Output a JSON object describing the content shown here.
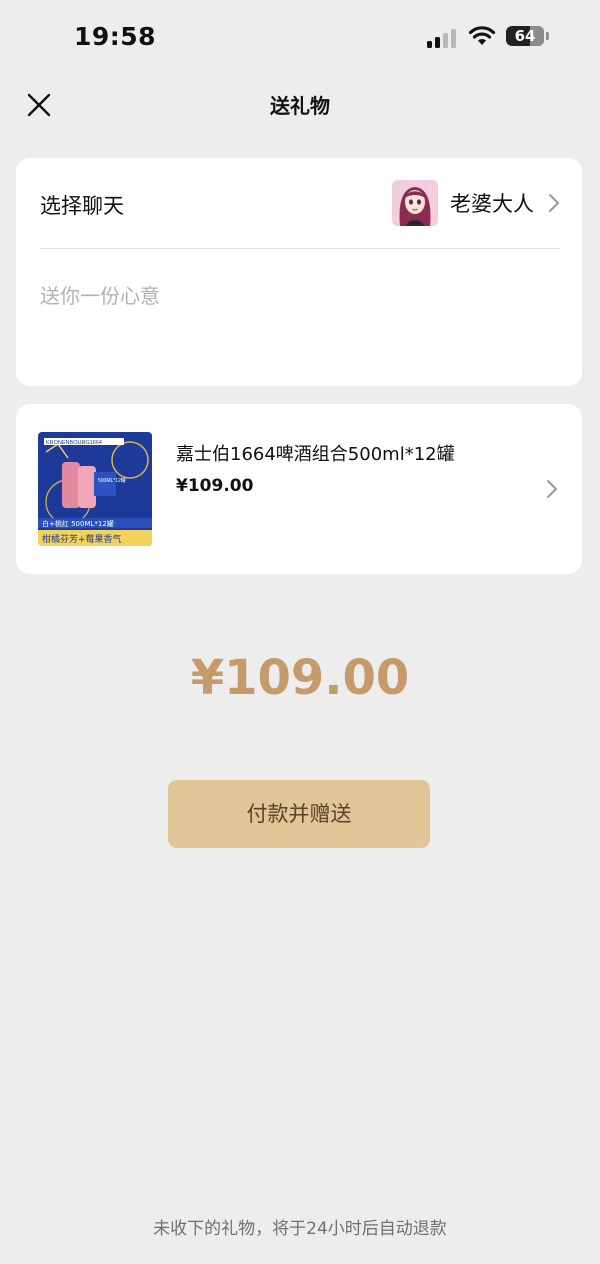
{
  "status_bar": {
    "time": "19:58",
    "battery": "64",
    "battery_level": 0.64
  },
  "nav": {
    "title": "送礼物",
    "close_icon": "close-icon"
  },
  "recipient_card": {
    "label": "选择聊天",
    "recipient_name": "老婆大人",
    "message_placeholder": "送你一份心意"
  },
  "product": {
    "name": "嘉士伯1664啤酒组合500ml*12罐",
    "price": "¥109.00",
    "thumb_text": {
      "brand": "KRONENBOURG1664",
      "pack": "500ML*12罐",
      "tagline": "白+桃红 500ML*12罐",
      "bottom": "柑橘芬芳+莓果香气"
    }
  },
  "total": "¥109.00",
  "pay_button": "付款并赠送",
  "footer_note": "未收下的礼物，将于24小时后自动退款",
  "colors": {
    "accent": "#c69a6a",
    "button_bg": "#e0c596",
    "button_text": "#5a4327",
    "background": "#ededed"
  }
}
